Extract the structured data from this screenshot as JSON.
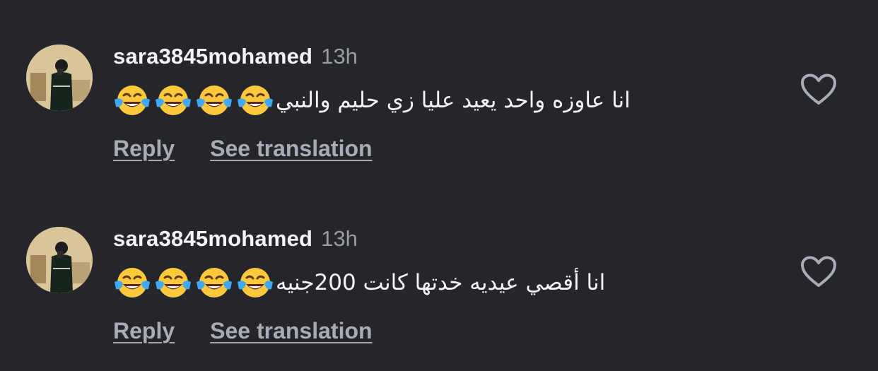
{
  "comments": [
    {
      "username": "sara3845mohamed",
      "timestamp": "13h",
      "text": "انا عاوزه واحد يعيد عليا زي حليم والنبي",
      "emoji": [
        "😂",
        "😂",
        "😂",
        "😂"
      ],
      "reply_label": "Reply",
      "translate_label": "See translation",
      "like_icon": "heart-outline-icon",
      "liked": false
    },
    {
      "username": "sara3845mohamed",
      "timestamp": "13h",
      "text": "انا أقصي عيديه خدتها كانت 200جنيه",
      "emoji": [
        "😂",
        "😂",
        "😂",
        "😂"
      ],
      "reply_label": "Reply",
      "translate_label": "See translation",
      "like_icon": "heart-outline-icon",
      "liked": false
    }
  ],
  "colors": {
    "background": "#24262b",
    "primary_text": "#f4f5f6",
    "secondary_text": "#9a9ca3",
    "link_text": "#a9acb3",
    "emoji_face": "#ffc83d",
    "emoji_tears": "#3fa9f5"
  }
}
